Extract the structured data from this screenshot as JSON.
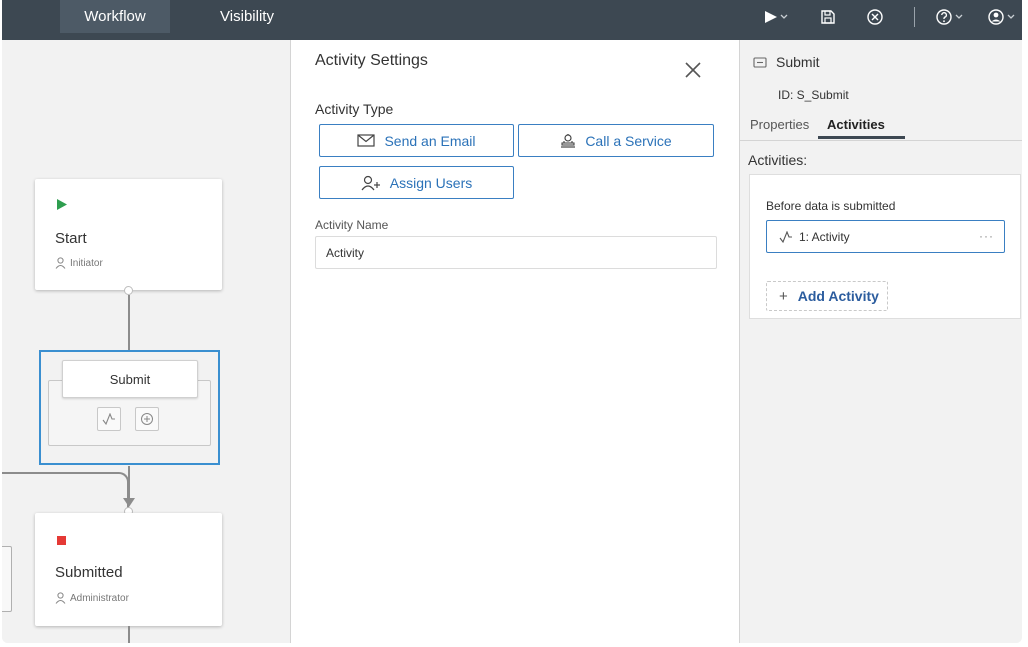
{
  "topbar": {
    "tabs": [
      {
        "label": "Workflow",
        "active": true
      },
      {
        "label": "Visibility",
        "active": false
      }
    ],
    "icons": [
      "play-icon",
      "save-icon",
      "cancel-icon",
      "help-icon",
      "user-icon"
    ]
  },
  "canvas": {
    "nodes": {
      "start": {
        "title": "Start",
        "assignee": "Initiator",
        "marker_color": "#2e9e4f"
      },
      "submit": {
        "label": "Submit",
        "selected_border": "#3a8fd0"
      },
      "submitted": {
        "title": "Submitted",
        "assignee": "Administrator",
        "marker_color": "#e53935"
      }
    }
  },
  "activity_settings": {
    "title": "Activity Settings",
    "type_label": "Activity Type",
    "types": {
      "send_email": "Send an Email",
      "call_service": "Call a Service",
      "assign_users": "Assign Users"
    },
    "name_label": "Activity Name",
    "name_value": "Activity"
  },
  "details": {
    "title": "Submit",
    "id_text": "ID:  S_Submit",
    "tabs": [
      {
        "label": "Properties",
        "active": false
      },
      {
        "label": "Activities",
        "active": true
      }
    ],
    "activities_label": "Activities:",
    "before_label": "Before data is submitted",
    "activity_item": "1: Activity",
    "more_label": "···",
    "add_label": "Add Activity",
    "add_symbol": "+"
  },
  "colors": {
    "topbar": "#3d4852",
    "accent_blue": "#3a7fc2",
    "link_blue": "#2b72b8"
  }
}
